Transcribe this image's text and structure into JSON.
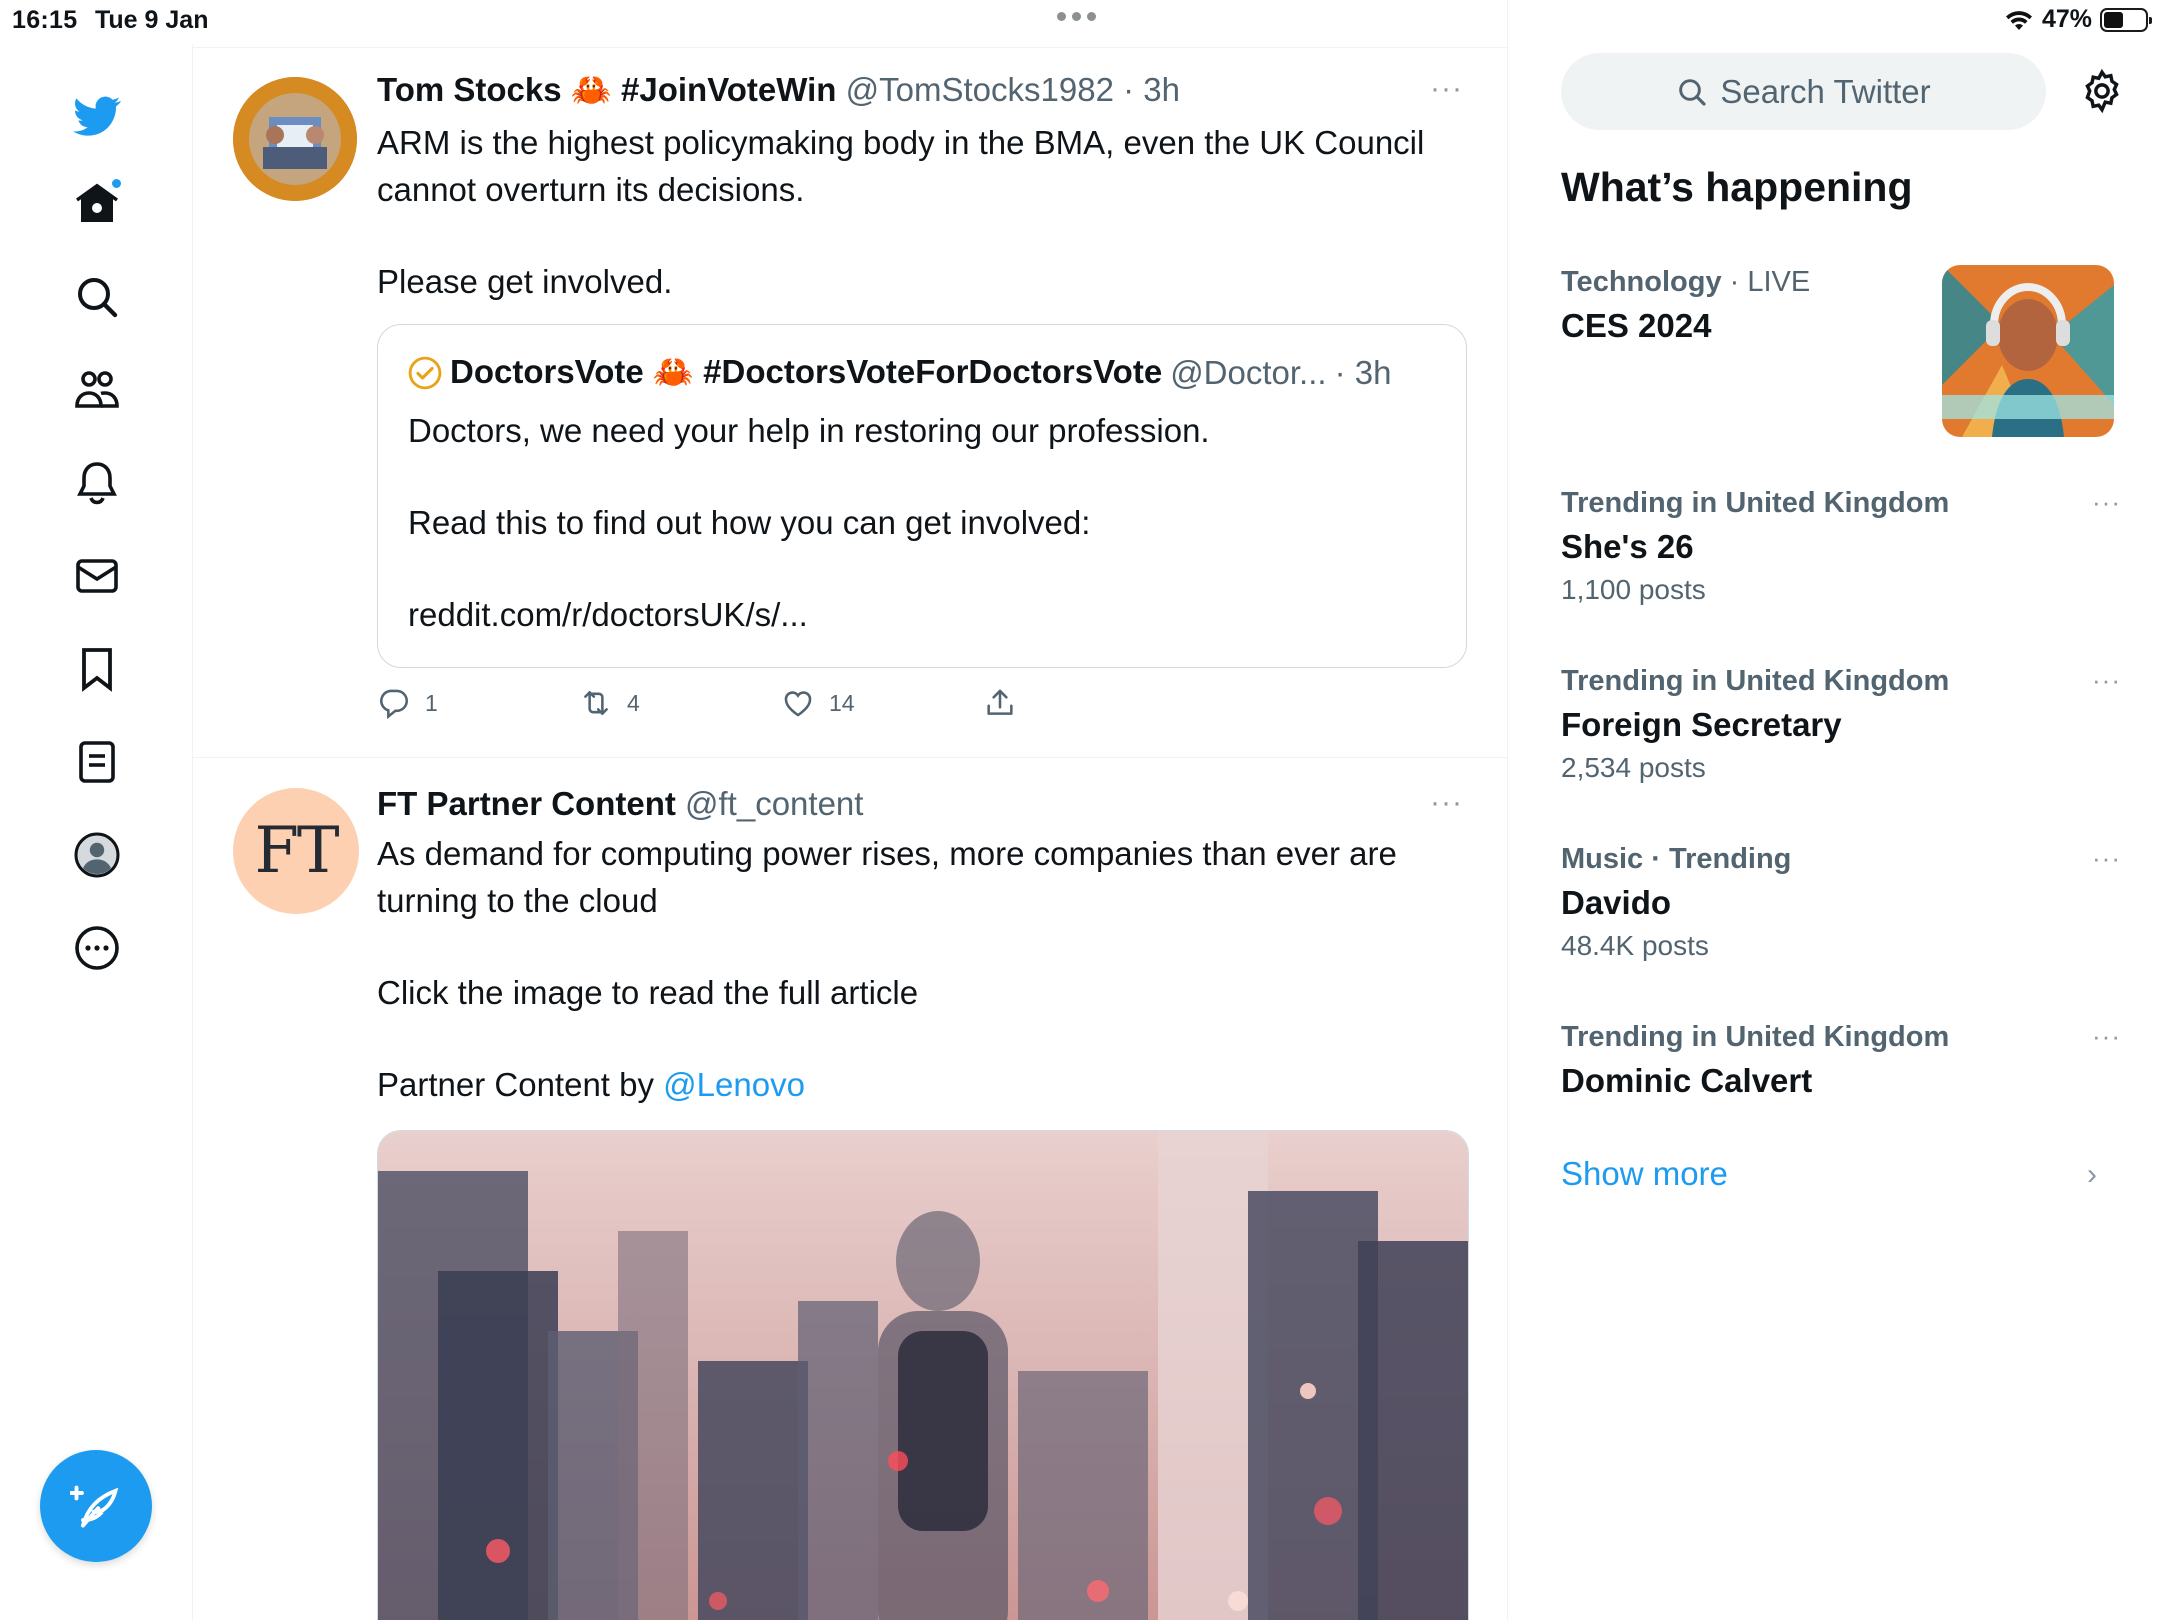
{
  "status": {
    "time": "16:15",
    "date": "Tue 9 Jan",
    "battery": "47%",
    "battery_level": 0.47
  },
  "nav": {
    "items": [
      "home-icon",
      "search-icon",
      "communities-icon",
      "notifications-icon",
      "messages-icon",
      "bookmarks-icon",
      "lists-icon",
      "profile-icon",
      "more-icon"
    ],
    "compose": "compose-icon"
  },
  "tweets": [
    {
      "name": "Tom Stocks 🦀 #JoinVoteWin",
      "handle": "@TomStocks1982",
      "time": "· 3h",
      "more": "···",
      "text": [
        "ARM is the highest policymaking body in the BMA, even the UK Council cannot overturn its decisions.",
        "Please get involved."
      ],
      "quote": {
        "name": "DoctorsVote 🦀 #DoctorsVoteForDoctorsVote",
        "handle": "@Doctor...",
        "time": "· 3h",
        "text": [
          "Doctors, we need your help in restoring our profession.",
          "Read this to find out how you can get involved:",
          "reddit.com/r/doctorsUK/s/..."
        ]
      },
      "actions": {
        "replies": "1",
        "retweets": "4",
        "likes": "14"
      }
    },
    {
      "name": "FT Partner Content",
      "handle": "@ft_content",
      "more": "···",
      "avatar_text": "FT",
      "text": [
        "As demand for computing power rises, more companies than ever are turning to the cloud",
        "Click the image to read the full article"
      ],
      "partner_prefix": "Partner Content by ",
      "partner_link": "@Lenovo"
    }
  ],
  "sidebar": {
    "search_placeholder": "Search Twitter",
    "title": "What’s happening",
    "trends": [
      {
        "category": "Technology",
        "category_suffix": " · LIVE",
        "name": "CES 2024",
        "count": ""
      },
      {
        "category": "Trending in United Kingdom",
        "name": "She's 26",
        "count": "1,100 posts"
      },
      {
        "category": "Trending in United Kingdom",
        "name": "Foreign Secretary",
        "count": "2,534 posts"
      },
      {
        "category": "Music · Trending",
        "name": "Davido",
        "count": "48.4K posts"
      },
      {
        "category": "Trending in United Kingdom",
        "name": "Dominic Calvert",
        "count": ""
      }
    ],
    "show_more": "Show more"
  },
  "colors": {
    "accent": "#1d9bf0",
    "text": "#0f1419",
    "secondary": "#536471",
    "border": "#eff3f4"
  }
}
